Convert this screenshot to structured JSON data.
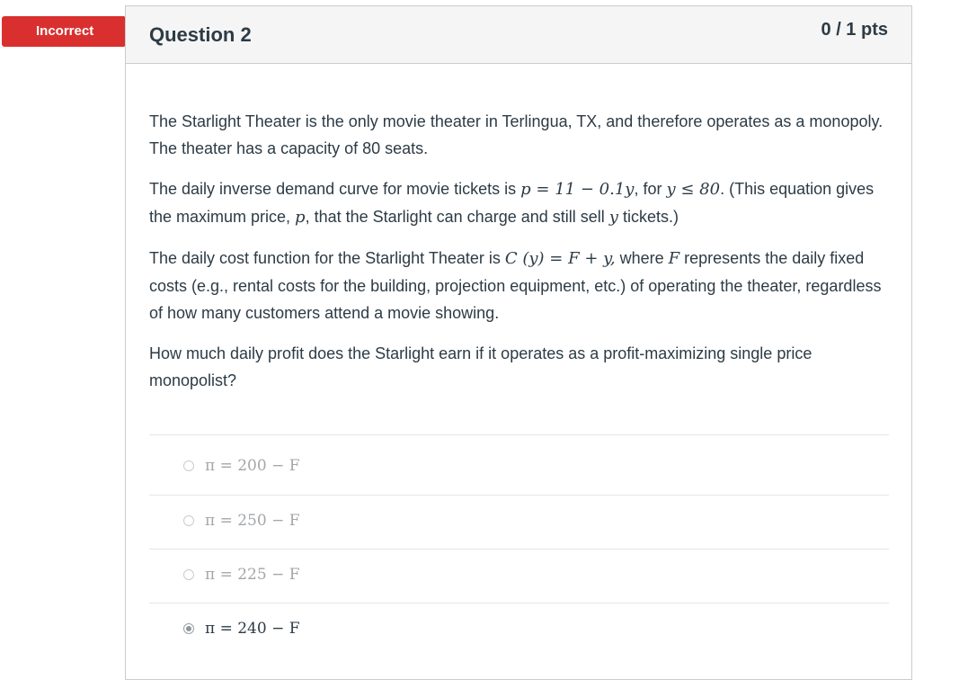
{
  "status_badge": "Incorrect",
  "question": {
    "title": "Question 2",
    "points": "0 / 1 pts"
  },
  "body": {
    "p1": "The Starlight Theater is the only movie theater in Terlingua, TX, and therefore operates as a monopoly.  The theater has a capacity of 80 seats.",
    "p2_a": "The daily inverse demand curve for movie tickets is ",
    "p2_eq": "p = 11 − 0.1y",
    "p2_b": ", for ",
    "p2_cond": "y ≤ 80",
    "p2_c": ".  (This equation gives the maximum price, ",
    "p2_p": "p",
    "p2_d": ", that the Starlight can charge and still sell ",
    "p2_y": "y",
    "p2_e": " tickets.)",
    "p3_a": "The daily cost function for the Starlight Theater is ",
    "p3_eq": "C (y) = F + y,",
    "p3_b": "  where ",
    "p3_F": "F",
    "p3_c": "  represents the daily fixed costs (e.g., rental costs for the building, projection equipment, etc.) of operating the theater, regardless of how many customers attend a movie showing.",
    "p4": "How much daily profit does the Starlight earn if it operates as a profit-maximizing single price monopolist?"
  },
  "answers": [
    {
      "text": "π = 200 − F",
      "selected": false
    },
    {
      "text": "π = 250 − F",
      "selected": false
    },
    {
      "text": "π = 225 − F",
      "selected": false
    },
    {
      "text": "π = 240 − F",
      "selected": true
    }
  ],
  "colors": {
    "incorrect": "#d9302f",
    "text": "#2d3b45",
    "muted": "#a3a7aa"
  }
}
